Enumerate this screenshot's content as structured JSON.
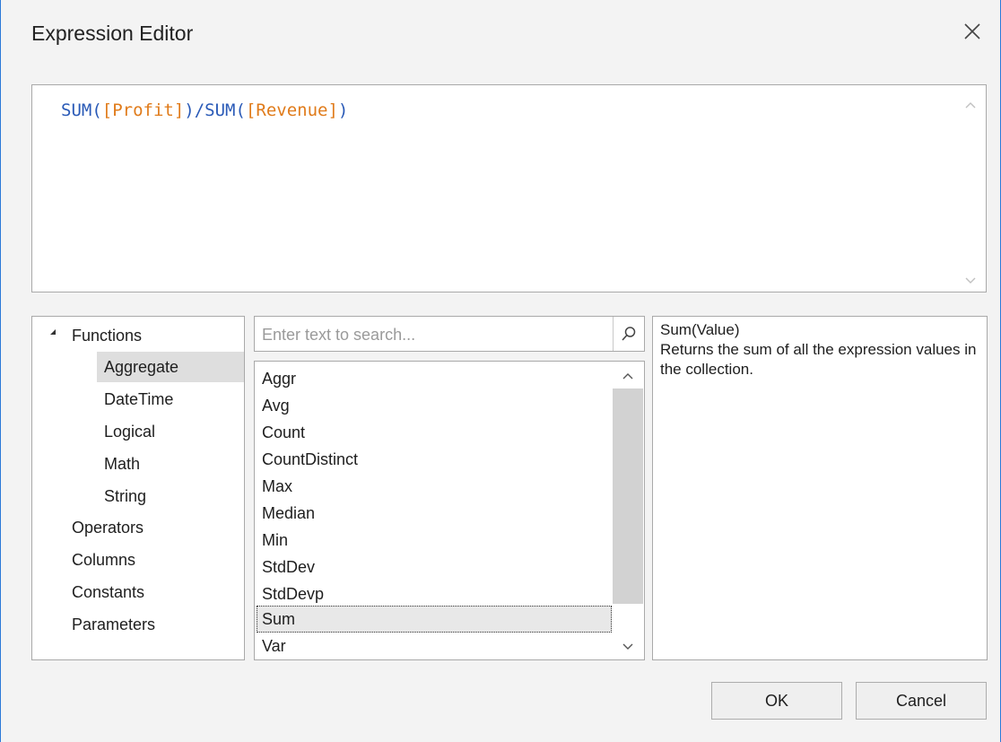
{
  "window": {
    "title": "Expression Editor",
    "close_icon": "close-icon"
  },
  "editor": {
    "tokens": [
      "SUM(",
      "[Profit]",
      ")/",
      "SUM(",
      "[Revenue]",
      ")"
    ],
    "colors": {
      "function": "#2a5ab7",
      "field": "#e07b1a"
    }
  },
  "tree": {
    "root": "Functions",
    "children": [
      "Aggregate",
      "DateTime",
      "Logical",
      "Math",
      "String"
    ],
    "selected": "Aggregate",
    "others": [
      "Operators",
      "Columns",
      "Constants",
      "Parameters"
    ]
  },
  "search": {
    "placeholder": "Enter text to search...",
    "value": "",
    "icon": "search-icon"
  },
  "functions": {
    "items": [
      "Aggr",
      "Avg",
      "Count",
      "CountDistinct",
      "Max",
      "Median",
      "Min",
      "StdDev",
      "StdDevp",
      "Sum",
      "Var"
    ],
    "selected": "Sum"
  },
  "description": {
    "signature": "Sum(Value)",
    "text": "Returns the sum of all the expression values in the collection."
  },
  "buttons": {
    "ok": "OK",
    "cancel": "Cancel"
  }
}
